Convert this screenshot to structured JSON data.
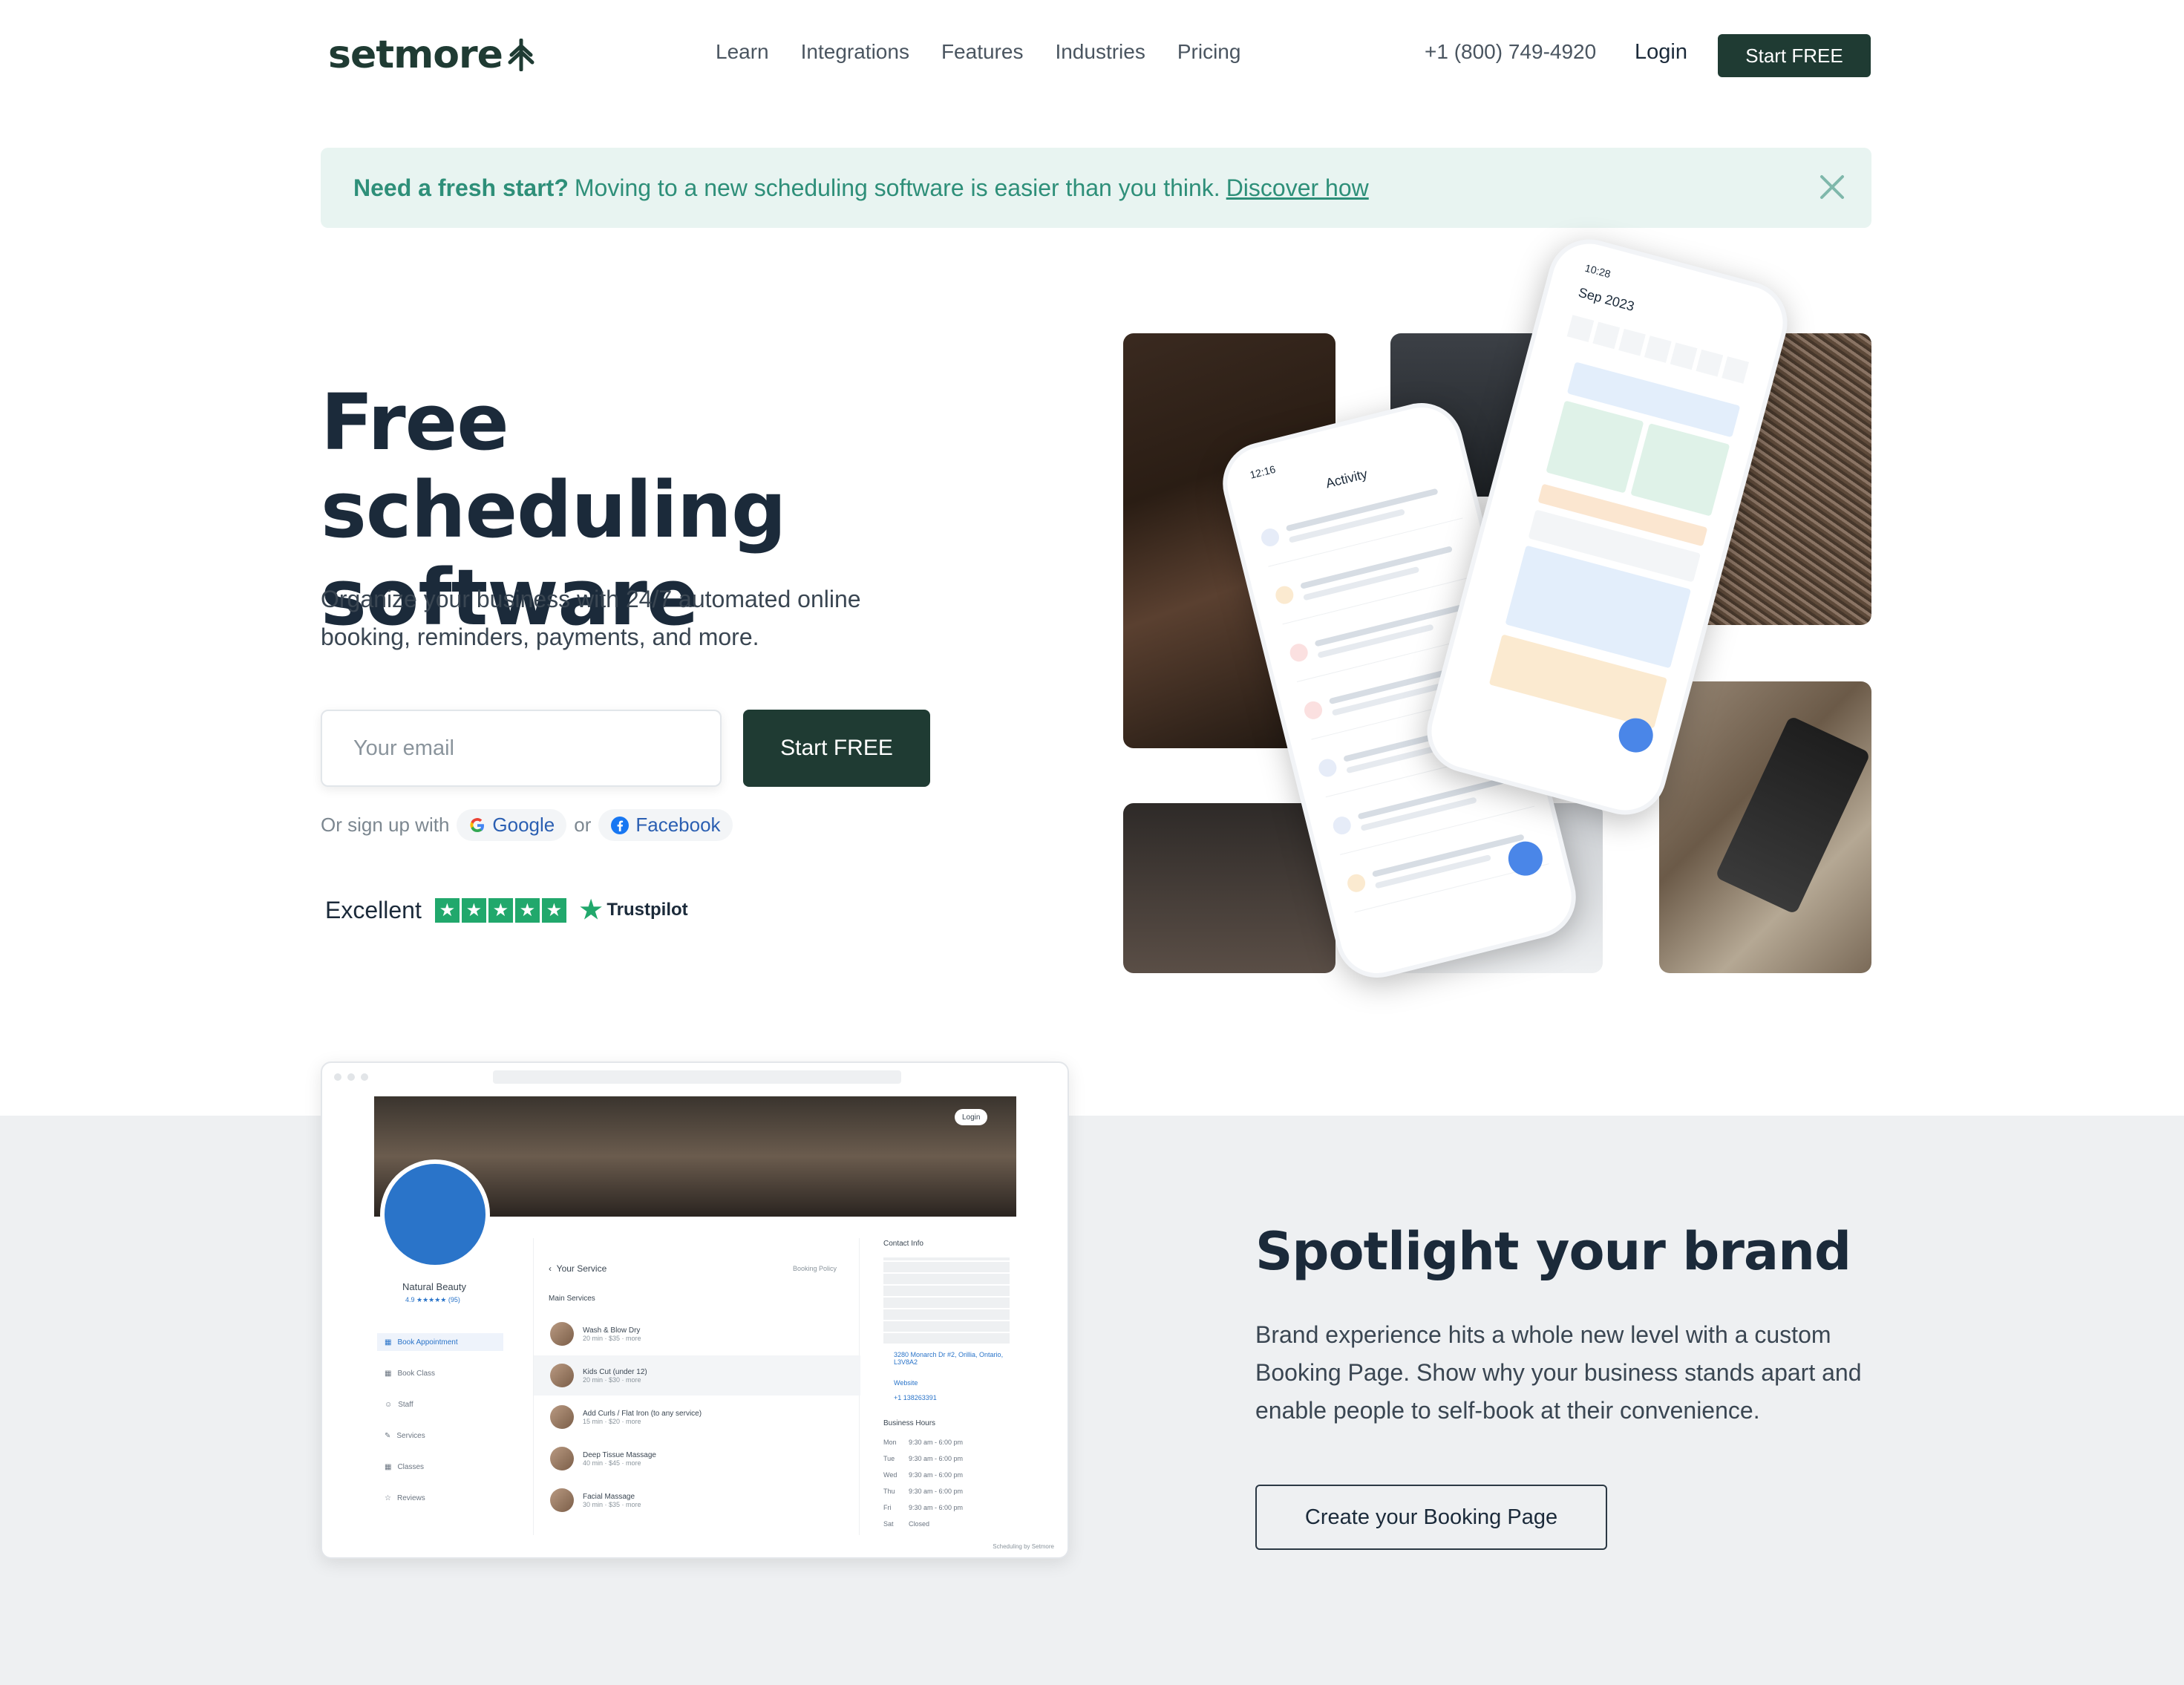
{
  "nav": {
    "logo": "setmore",
    "links": [
      "Learn",
      "Integrations",
      "Features",
      "Industries",
      "Pricing"
    ],
    "phone": "+1 (800) 749-4920",
    "login": "Login",
    "cta": "Start FREE"
  },
  "banner": {
    "bold": "Need a fresh start?",
    "text": "Moving to a new scheduling software is easier than you think.",
    "link": "Discover how"
  },
  "hero": {
    "title_line1": "Free scheduling",
    "title_line2": "software",
    "subtitle": "Organize your business with 24/7 automated online booking, reminders, payments, and more.",
    "email_placeholder": "Your email",
    "cta": "Start FREE",
    "signup_prefix": "Or sign up with",
    "google": "Google",
    "or": "or",
    "facebook": "Facebook",
    "rating_text": "Excellent",
    "trustpilot": "Trustpilot"
  },
  "phones": {
    "activity_title": "Activity",
    "activity_time": "12:16",
    "calendar_time": "10:28",
    "calendar_month": "Sep 2023"
  },
  "booking_page": {
    "business_name": "Natural Beauty",
    "rating": "4.9 ★★★★★ (95)",
    "login": "Login",
    "sidebar": [
      "Book Appointment",
      "Book Class",
      "Staff",
      "Services",
      "Classes",
      "Reviews"
    ],
    "panel_title": "Your Service",
    "booking_policy": "Booking Policy",
    "main_services": "Main Services",
    "services": [
      {
        "name": "Wash & Blow Dry",
        "meta": "20 min · $35 · more"
      },
      {
        "name": "Kids Cut (under 12)",
        "meta": "20 min · $30 · more"
      },
      {
        "name": "Add Curls / Flat Iron (to any service)",
        "meta": "15 min · $20 · more"
      },
      {
        "name": "Deep Tissue Massage",
        "meta": "40 min · $45 · more"
      },
      {
        "name": "Facial Massage",
        "meta": "30 min · $35 · more"
      }
    ],
    "contact_title": "Contact Info",
    "address": "3280 Monarch Dr #2, Orillia, Ontario, L3V8A2",
    "website": "Website",
    "phone": "+1 138263391",
    "hours_title": "Business Hours",
    "hours": [
      {
        "day": "Mon",
        "time": "9:30 am - 6:00 pm"
      },
      {
        "day": "Tue",
        "time": "9:30 am - 6:00 pm"
      },
      {
        "day": "Wed",
        "time": "9:30 am - 6:00 pm"
      },
      {
        "day": "Thu",
        "time": "9:30 am - 6:00 pm"
      },
      {
        "day": "Fri",
        "time": "9:30 am - 6:00 pm"
      },
      {
        "day": "Sat",
        "time": "Closed"
      }
    ],
    "footer": "Scheduling by Setmore"
  },
  "spotlight": {
    "title": "Spotlight your brand",
    "text": "Brand experience hits a whole new level with a custom Booking Page. Show why your business stands apart and enable people to self-book at their convenience.",
    "cta": "Create your Booking Page"
  },
  "colors": {
    "brand_dark": "#1f3b33",
    "banner_bg": "#e8f4f1",
    "banner_text": "#2e8f79",
    "trust_green": "#21a86c",
    "section_gray": "#eef0f2"
  }
}
